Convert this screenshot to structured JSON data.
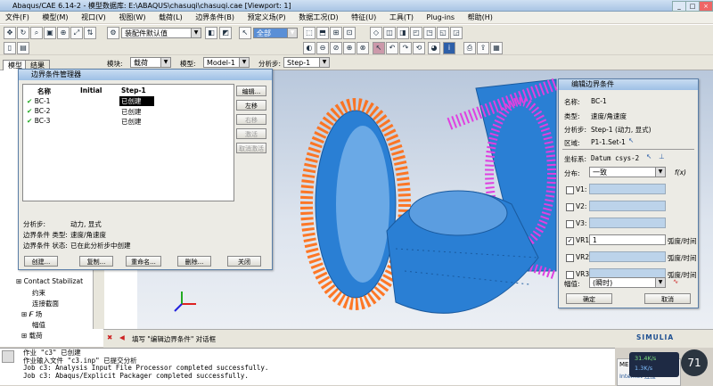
{
  "window": {
    "title": "Abaqus/CAE 6.14-2 - 模型数据库: E:\\ABAQUS\\chasuqi\\chasuqi.cae [Viewport: 1]"
  },
  "menu": [
    "文件(F)",
    "模型(M)",
    "视口(V)",
    "视图(W)",
    "载荷(L)",
    "边界条件(B)",
    "预定义场(P)",
    "数据工况(D)",
    "特征(U)",
    "工具(T)",
    "Plug-ins",
    "帮助(H)"
  ],
  "toolbar": {
    "assembly_combo": "装配件默认值",
    "select_combo": "全部"
  },
  "context": {
    "module_label": "模块:",
    "module_value": "载荷",
    "model_label": "模型:",
    "model_value": "Model-1",
    "step_label": "分析步:",
    "step_value": "Step-1"
  },
  "model_tabs": [
    "模型",
    "结果"
  ],
  "tree": {
    "items": [
      "Contact Stabilizat",
      "约束",
      "连接截面",
      "场",
      "幅值",
      "载荷"
    ]
  },
  "bc_manager": {
    "title": "边界条件管理器",
    "col_name": "名称",
    "col_initial": "Initial",
    "col_step": "Step-1",
    "rows": [
      {
        "name": "BC-1",
        "status": "已创建"
      },
      {
        "name": "BC-2",
        "status": "已创建"
      },
      {
        "name": "BC-3",
        "status": "已创建"
      }
    ],
    "side_buttons": [
      "编辑...",
      "左移",
      "右移",
      "激活",
      "取消激活"
    ],
    "info_step_label": "分析步:",
    "info_step_value": "动力, 显式",
    "info_type_label": "边界条件 类型:",
    "info_type_value": "速度/角速度",
    "info_state_label": "边界条件 状态:",
    "info_state_value": "已在此分析步中创建",
    "bottom_buttons": [
      "创建...",
      "复制...",
      "重命名...",
      "删除...",
      "关闭"
    ]
  },
  "edit_bc": {
    "title": "编辑边界条件",
    "name_label": "名称:",
    "name_value": "BC-1",
    "type_label": "类型:",
    "type_value": "速度/角速度",
    "step_label": "分析步:",
    "step_value": "Step-1 (动力, 显式)",
    "region_label": "区域:",
    "region_value": "P1-1.Set-1",
    "csys_label": "坐标系:",
    "csys_value": "Datum csys-2",
    "dist_label": "分布:",
    "dist_value": "一致",
    "fx": "f(x)",
    "rows": [
      {
        "label": "V1:",
        "checked": false,
        "value": ""
      },
      {
        "label": "V2:",
        "checked": false,
        "value": ""
      },
      {
        "label": "V3:",
        "checked": false,
        "value": ""
      },
      {
        "label": "VR1:",
        "checked": true,
        "value": "1",
        "unit": "弧度/时间"
      },
      {
        "label": "VR2:",
        "checked": false,
        "value": "",
        "unit": "弧度/时间"
      },
      {
        "label": "VR3:",
        "checked": false,
        "value": "",
        "unit": "弧度/时间"
      }
    ],
    "amp_label": "幅值:",
    "amp_value": "(瞬时)",
    "ok": "确定",
    "cancel": "取消"
  },
  "prompt": "填写 \"编辑边界条件\" 对话框",
  "brand": "SIMULIA",
  "messages": [
    "作业 \"c3\" 已创建",
    "作业输入文件 \"c3.inp\" 已提交分析",
    "Job c3: Analysis Input File Processor completed successfully.",
    "Job c3: Abaqus/Explicit Packager completed successfully."
  ],
  "tray": {
    "brand": "MERCUR",
    "sub": "Internet 连接",
    "percent": "71",
    "up": "31.4K/s",
    "down": "1.3K/s"
  },
  "colors": {
    "gear": "#2a7fd4",
    "arrow_orange": "#ff6a10",
    "arrow_magenta": "#e040e0"
  }
}
